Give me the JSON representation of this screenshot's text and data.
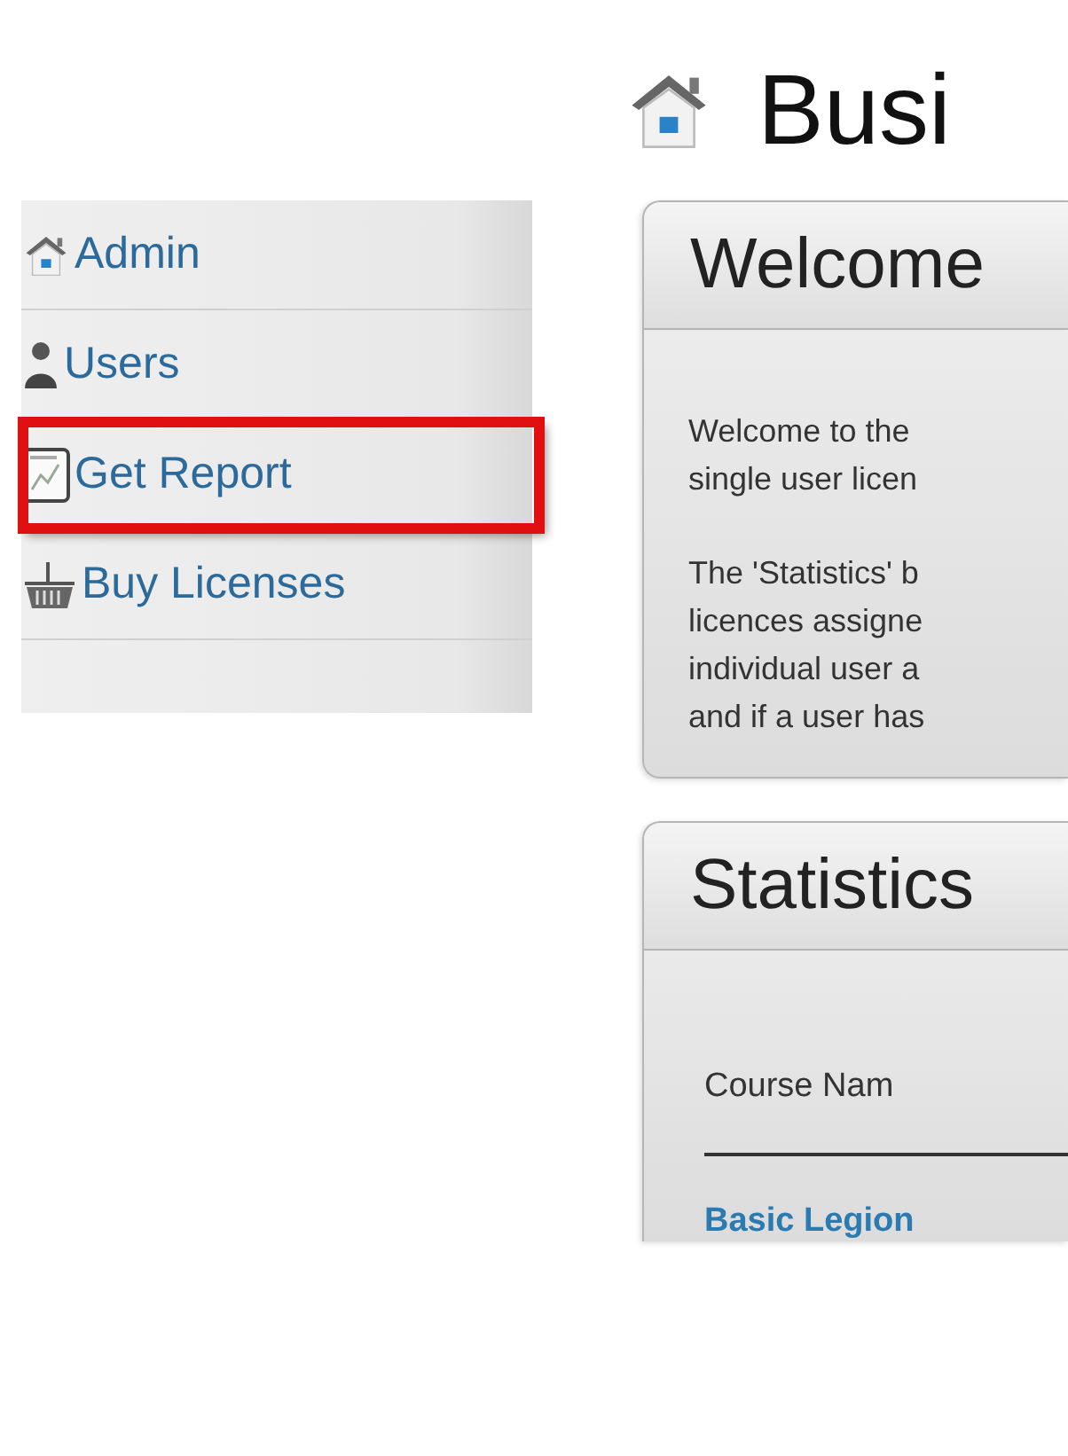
{
  "page_title": "Busi",
  "sidebar": {
    "items": [
      {
        "label": "Admin",
        "kind": "home",
        "highlighted": false
      },
      {
        "label": "Users",
        "kind": "user",
        "highlighted": false
      },
      {
        "label": "Get Report",
        "kind": "report",
        "highlighted": true
      },
      {
        "label": "Buy Licenses",
        "kind": "basket",
        "highlighted": false
      }
    ]
  },
  "panels": [
    {
      "title": "Welcome",
      "kind": "text",
      "paragraphs": [
        [
          "Welcome to the",
          "single user licen"
        ],
        [
          "The 'Statistics' b",
          "licences assigne",
          "individual user a",
          "and if a user has"
        ]
      ]
    },
    {
      "title": "Statistics",
      "kind": "table",
      "column": "Course Nam",
      "rows": [
        "Basic Legion"
      ]
    }
  ]
}
